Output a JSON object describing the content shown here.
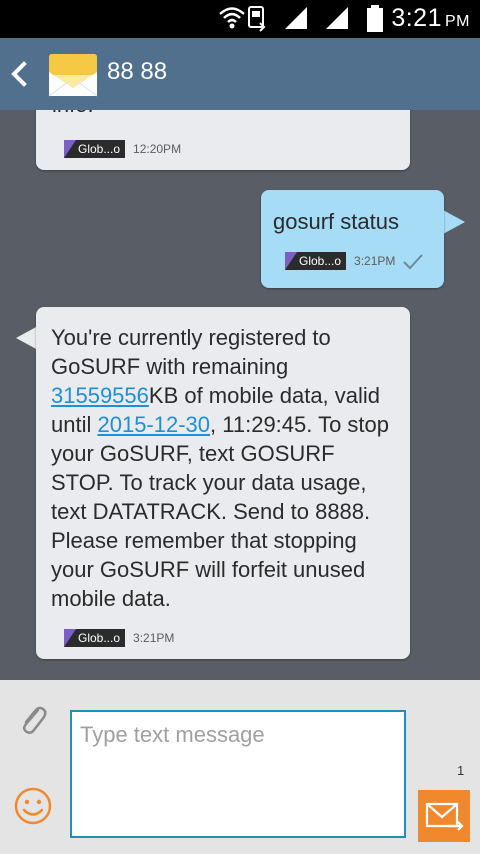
{
  "status_bar": {
    "time": "3:21",
    "ampm": "PM",
    "icons": [
      "wifi-icon",
      "sim-data-icon",
      "signal-icon-1",
      "signal-icon-2",
      "battery-icon"
    ]
  },
  "action_bar": {
    "contact_name": "88 88",
    "icons": [
      "back-chevron-icon",
      "envelope-contact-icon"
    ]
  },
  "messages": [
    {
      "direction": "incoming",
      "text_partial": "info.",
      "sim_label": "Glob...o",
      "time": "12:20PM"
    },
    {
      "direction": "outgoing",
      "text": "gosurf status",
      "sim_label": "Glob...o",
      "time": "3:21PM",
      "status_icon": "delivered-check-icon"
    },
    {
      "direction": "incoming",
      "text_part1": "You're currently registered to GoSURF with remaining ",
      "link1": "31559556",
      "text_part2": "KB of mobile data, valid until ",
      "link2": "2015-12-30",
      "text_part3": ", 11:29:45. To stop your GoSURF, text GOSURF STOP. To track your data usage, text DATATRACK. Send to 8888. Please remember that stopping your GoSURF will forfeit unused mobile data.",
      "sim_label": "Glob...o",
      "time": "3:21PM"
    }
  ],
  "compose": {
    "placeholder": "Type text message",
    "page_counter": "1",
    "icons": [
      "paperclip-attach-icon",
      "smiley-emoji-icon",
      "send-envelope-icon"
    ]
  },
  "colors": {
    "action_bar": "#50708d",
    "conversation_bg": "#595e66",
    "incoming_bubble": "#e9ebee",
    "outgoing_bubble": "#a6dcf6",
    "link": "#1e8fd8",
    "send_button": "#f0882e",
    "input_border": "#1e8fb8"
  }
}
